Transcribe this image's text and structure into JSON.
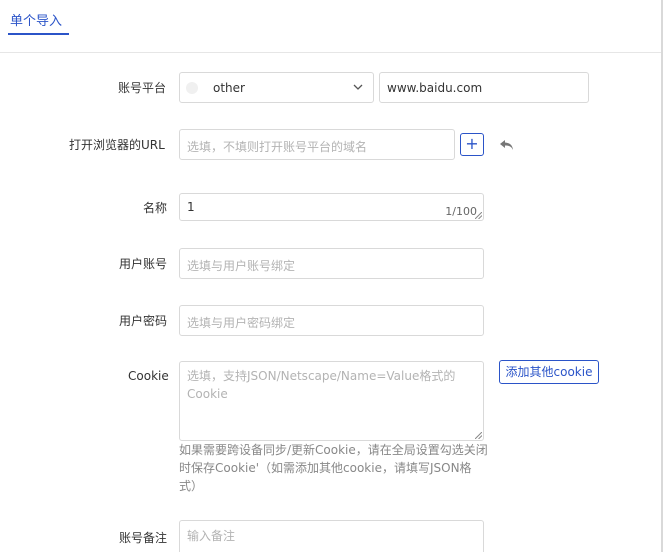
{
  "tabs": [
    {
      "label": "单个导入",
      "active": true
    }
  ],
  "form": {
    "platform": {
      "label": "账号平台",
      "selected": "other",
      "url_value": "www.baidu.com"
    },
    "open_url": {
      "label": "打开浏览器的URL",
      "placeholder": "选填，不填则打开账号平台的域名",
      "add_label": "+"
    },
    "name": {
      "label": "名称",
      "value": "1",
      "counter": "1/100"
    },
    "username": {
      "label": "用户账号",
      "placeholder": "选填与用户账号绑定"
    },
    "password": {
      "label": "用户密码",
      "placeholder": "选填与用户密码绑定"
    },
    "cookie": {
      "label": "Cookie",
      "placeholder": "选填，支持JSON/Netscape/Name=Value格式的Cookie",
      "add_button": "添加其他cookie",
      "hint": "如果需要跨设备同步/更新Cookie，请在全局设置勾选关闭时保存Cookie'（如需添加其他cookie，请填写JSON格式）"
    },
    "remark": {
      "label": "账号备注",
      "placeholder": "输入备注"
    }
  },
  "colors": {
    "accent": "#2b54c8",
    "border": "#d9d9d9",
    "placeholder": "#b3b3b3"
  }
}
